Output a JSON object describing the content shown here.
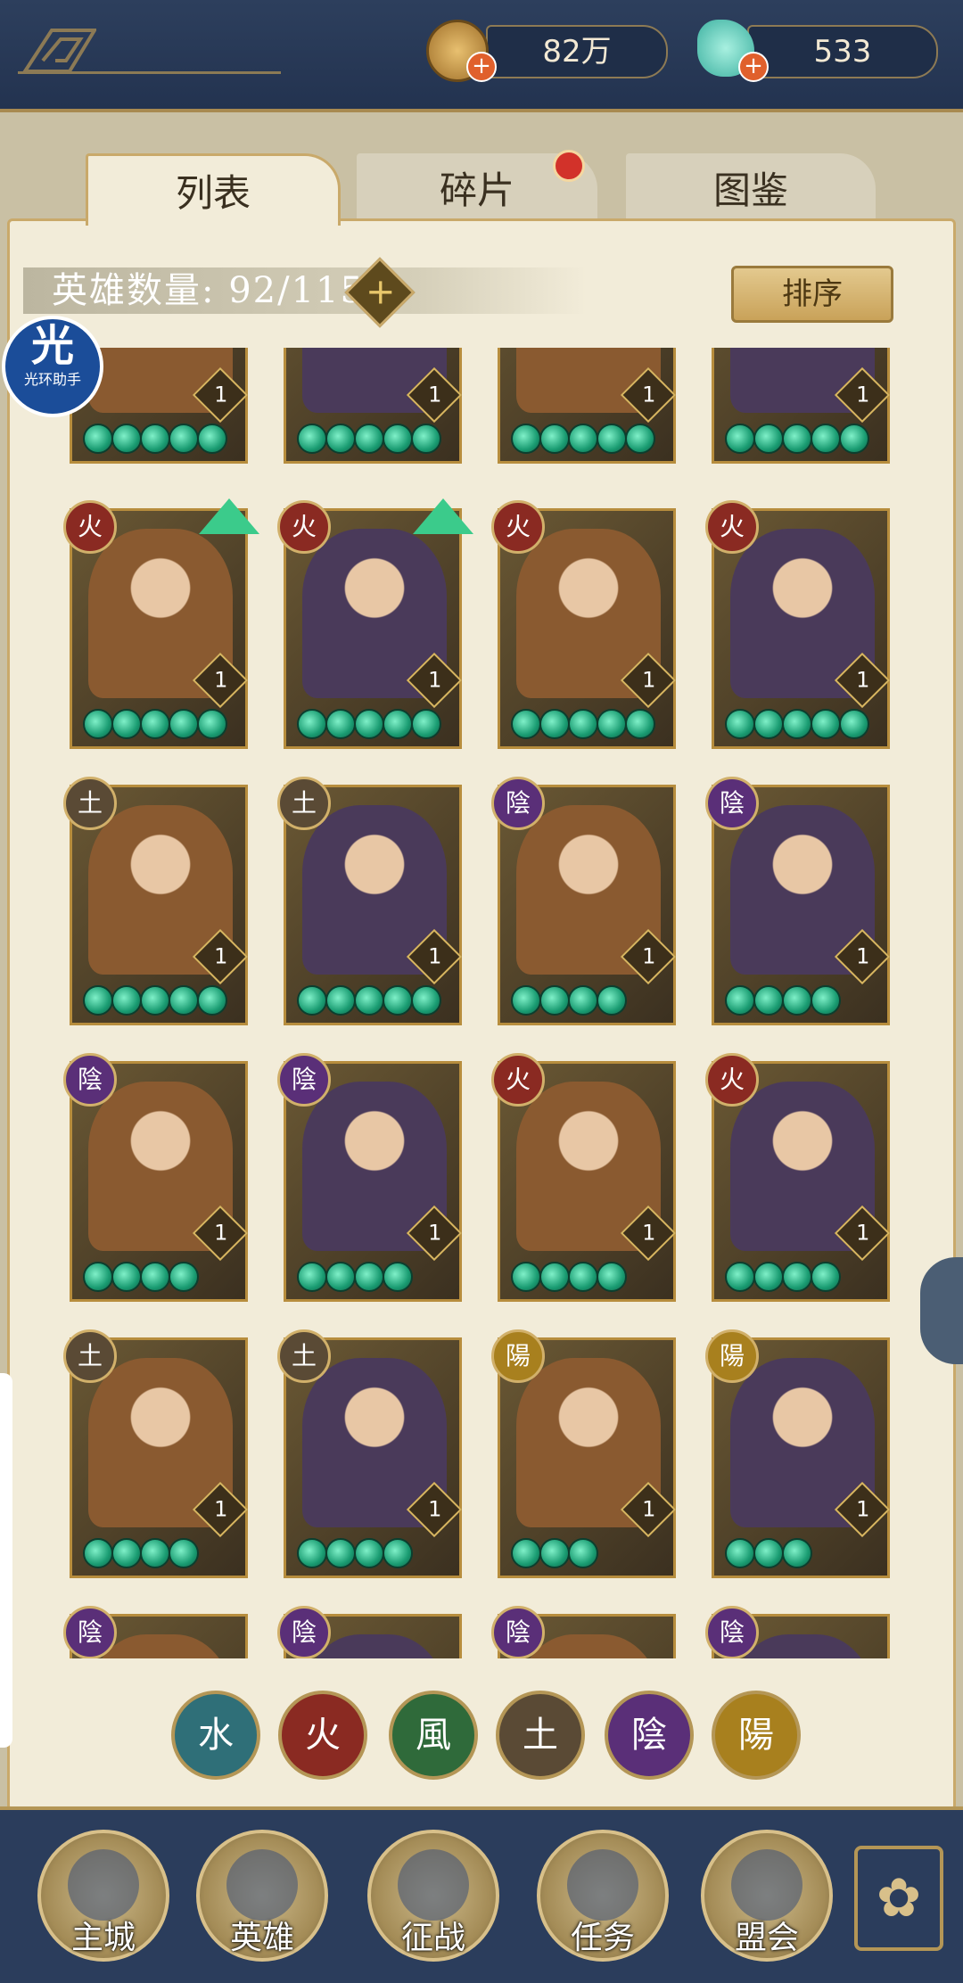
{
  "resources": {
    "coins": "82万",
    "gems": "533"
  },
  "tabs": [
    {
      "label": "列表",
      "active": true
    },
    {
      "label": "碎片",
      "active": false,
      "has_notification": true
    },
    {
      "label": "图鉴",
      "active": false
    }
  ],
  "hero_count": {
    "label": "英雄数量: 92/115"
  },
  "sort_button": "排序",
  "overlay_helper": {
    "glyph": "光",
    "label": "光环助手"
  },
  "heroes": [
    {
      "element": "",
      "level": "1",
      "stars": 5,
      "upgradable": false
    },
    {
      "element": "",
      "level": "1",
      "stars": 5,
      "upgradable": false
    },
    {
      "element": "",
      "level": "1",
      "stars": 5,
      "upgradable": false
    },
    {
      "element": "",
      "level": "1",
      "stars": 5,
      "upgradable": false
    },
    {
      "element": "火",
      "level": "1",
      "stars": 5,
      "upgradable": true
    },
    {
      "element": "火",
      "level": "1",
      "stars": 5,
      "upgradable": true
    },
    {
      "element": "火",
      "level": "1",
      "stars": 5,
      "upgradable": false
    },
    {
      "element": "火",
      "level": "1",
      "stars": 5,
      "upgradable": false
    },
    {
      "element": "土",
      "level": "1",
      "stars": 5,
      "upgradable": false
    },
    {
      "element": "土",
      "level": "1",
      "stars": 5,
      "upgradable": false
    },
    {
      "element": "陰",
      "level": "1",
      "stars": 4,
      "upgradable": false
    },
    {
      "element": "陰",
      "level": "1",
      "stars": 4,
      "upgradable": false
    },
    {
      "element": "陰",
      "level": "1",
      "stars": 4,
      "upgradable": false
    },
    {
      "element": "陰",
      "level": "1",
      "stars": 4,
      "upgradable": false
    },
    {
      "element": "火",
      "level": "1",
      "stars": 4,
      "upgradable": false
    },
    {
      "element": "火",
      "level": "1",
      "stars": 4,
      "upgradable": false
    },
    {
      "element": "土",
      "level": "1",
      "stars": 4,
      "upgradable": false
    },
    {
      "element": "土",
      "level": "1",
      "stars": 4,
      "upgradable": false
    },
    {
      "element": "陽",
      "level": "1",
      "stars": 3,
      "upgradable": false
    },
    {
      "element": "陽",
      "level": "1",
      "stars": 3,
      "upgradable": false
    },
    {
      "element": "陰",
      "level": "",
      "stars": 0,
      "upgradable": false
    },
    {
      "element": "陰",
      "level": "",
      "stars": 0,
      "upgradable": false
    },
    {
      "element": "陰",
      "level": "",
      "stars": 0,
      "upgradable": false
    },
    {
      "element": "陰",
      "level": "",
      "stars": 0,
      "upgradable": false
    }
  ],
  "element_filters": [
    {
      "glyph": "水",
      "color": "#2f6f78"
    },
    {
      "glyph": "火",
      "color": "#8a2a22"
    },
    {
      "glyph": "風",
      "color": "#2f6a3a"
    },
    {
      "glyph": "土",
      "color": "#5a4a35"
    },
    {
      "glyph": "陰",
      "color": "#5a2f78"
    },
    {
      "glyph": "陽",
      "color": "#a8801e"
    }
  ],
  "element_colors": {
    "火": "#8a2a22",
    "土": "#5a4a35",
    "陰": "#5a2f78",
    "陽": "#a8801e",
    "": "#3b3020"
  },
  "bottom_nav": [
    {
      "label": "主城",
      "icon": "palace-icon"
    },
    {
      "label": "英雄",
      "icon": "hero-portrait-icon"
    },
    {
      "label": "征战",
      "icon": "scroll-icon"
    },
    {
      "label": "任务",
      "icon": "quest-scroll-icon"
    },
    {
      "label": "盟会",
      "icon": "pavilion-icon"
    }
  ]
}
